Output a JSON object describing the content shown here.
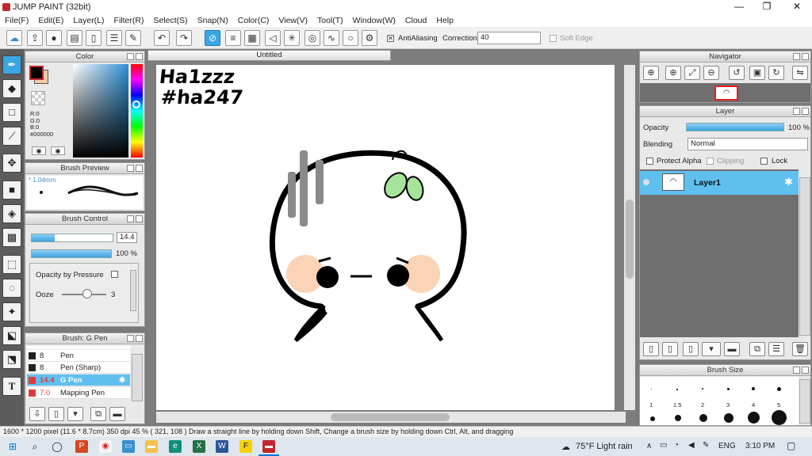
{
  "window": {
    "title": "JUMP PAINT (32bit)",
    "minimize": "—",
    "restore": "❐",
    "close": "✕"
  },
  "menu": [
    "File(F)",
    "Edit(E)",
    "Layer(L)",
    "Filter(R)",
    "Select(S)",
    "Snap(N)",
    "Color(C)",
    "View(V)",
    "Tool(T)",
    "Window(W)",
    "Cloud",
    "Help"
  ],
  "toolbar": {
    "antialiasing_label": "AntiAliasing",
    "correction_label": "Correction",
    "correction_value": "40",
    "soft_edge_label": "Soft Edge"
  },
  "color_panel": {
    "title": "Color",
    "r": "R:0",
    "g": "G:0",
    "b": "B:0",
    "hex": "#000000",
    "fg_color": "#000000",
    "bg_color": "#f5c9a8"
  },
  "brush_preview": {
    "title": "Brush Preview",
    "size": "1.04mm"
  },
  "brush_control": {
    "title": "Brush Control",
    "size_value": "14.4",
    "size_fill": 0.28,
    "opacity_value": "100 %",
    "opacity_fill": 1.0,
    "opacity_by_pressure": "Opacity by Pressure",
    "ooze_label": "Ooze",
    "ooze_value": "3"
  },
  "brush_list": {
    "title": "Brush: G Pen",
    "items": [
      {
        "size": "8",
        "name": "Pen",
        "color": "#222222"
      },
      {
        "size": "8",
        "name": "Pen (Sharp)",
        "color": "#222222"
      },
      {
        "size": "14.4",
        "name": "G Pen",
        "color": "#e03a3a",
        "selected": true
      },
      {
        "size": "7.0",
        "name": "Mapping Pen",
        "color": "#e03a3a"
      }
    ]
  },
  "document": {
    "tab": "Untitled",
    "handwriting_line1": "Ha1zzz",
    "handwriting_line2": "#ha247"
  },
  "navigator": {
    "title": "Navigator"
  },
  "layer_panel": {
    "title": "Layer",
    "opacity_label": "Opacity",
    "opacity_value": "100 %",
    "blending_label": "Blending",
    "blending_value": "Normal",
    "protect_alpha": "Protect Alpha",
    "clipping": "Clipping",
    "lock": "Lock",
    "layer_name": "Layer1"
  },
  "brush_size": {
    "title": "Brush Size",
    "labels": [
      "1",
      "1.5",
      "2",
      "3",
      "4",
      "5"
    ]
  },
  "status": "1600 * 1200 pixel   (11.6 * 8.7cm)   350 dpi   45 %   ( 321, 108 )   Draw a straight line by holding down Shift, Change a brush size by holding down Ctrl, Alt, and dragging",
  "taskbar": {
    "weather": "75°F  Light rain",
    "lang": "ENG",
    "time": "3:10 PM"
  }
}
